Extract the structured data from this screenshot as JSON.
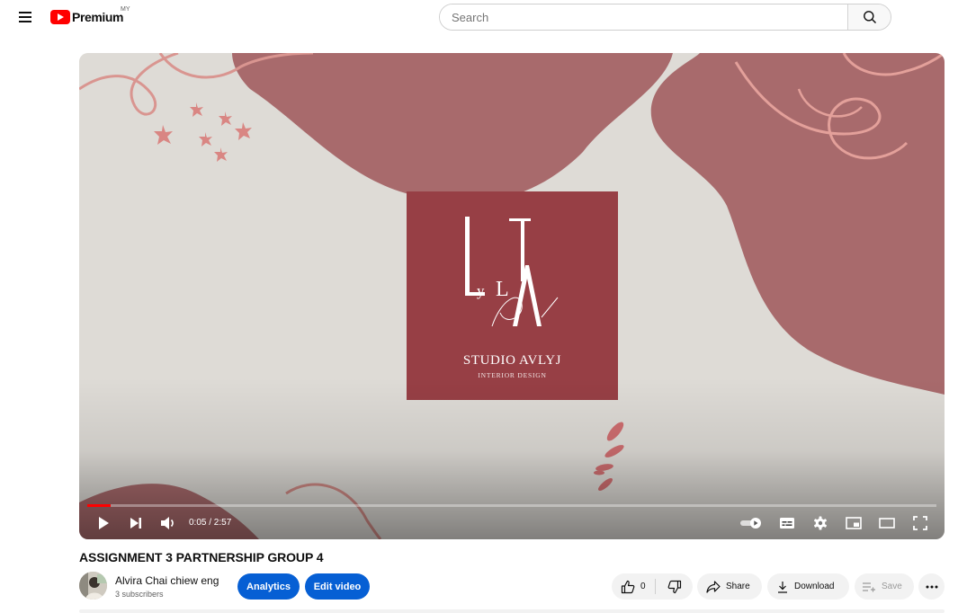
{
  "header": {
    "logo_text": "Premium",
    "logo_region": "MY",
    "search_placeholder": "Search"
  },
  "video": {
    "thumbnail": {
      "studio_name": "STUDIO AVLYJ",
      "studio_subtitle": "INTERIOR DESIGN"
    },
    "time_current": "0:05",
    "time_total": "2:57",
    "time_display": "0:05 / 2:57",
    "progress_fraction": 0.028
  },
  "meta": {
    "title": "ASSIGNMENT 3 PARTNERSHIP GROUP 4",
    "channel_name": "Alvira Chai chiew eng",
    "subscribers": "3 subscribers",
    "analytics_label": "Analytics",
    "edit_label": "Edit video",
    "like_count": "0",
    "share_label": "Share",
    "download_label": "Download",
    "save_label": "Save"
  },
  "colors": {
    "brand_red": "#ff0000",
    "accent_blue": "#065fd4",
    "thumbnail_maroon": "#973f45",
    "thumbnail_rose": "#a86a6c",
    "thumbnail_cream": "#dedbd6"
  },
  "icons": {
    "menu": "hamburger-icon",
    "search": "search-icon",
    "play": "play-icon",
    "next": "next-icon",
    "volume": "volume-icon",
    "autoplay": "autoplay-toggle-icon",
    "captions": "captions-icon",
    "settings": "gear-icon",
    "miniplayer": "miniplayer-icon",
    "theater": "theater-icon",
    "fullscreen": "fullscreen-icon",
    "like": "thumbs-up-icon",
    "dislike": "thumbs-down-icon",
    "share": "share-icon",
    "download": "download-icon",
    "save": "add-to-playlist-icon",
    "more": "more-icon"
  }
}
